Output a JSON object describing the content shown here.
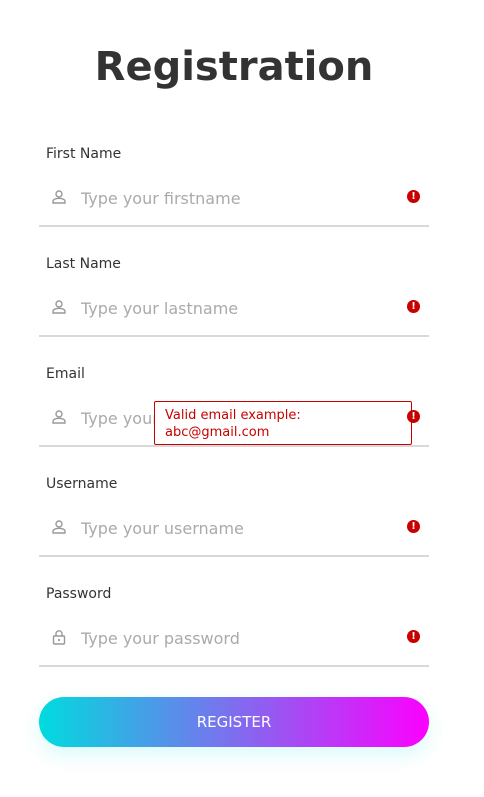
{
  "page": {
    "title": "Registration"
  },
  "colors": {
    "error": "#c80000",
    "gradient_start": "#00dbde",
    "gradient_end": "#fc00ff"
  },
  "fields": [
    {
      "label": "First Name",
      "placeholder": "Type your firstname",
      "value": "",
      "icon": "user-icon"
    },
    {
      "label": "Last Name",
      "placeholder": "Type your lastname",
      "value": "",
      "icon": "user-icon"
    },
    {
      "label": "Email",
      "placeholder": "Type your email",
      "value": "",
      "icon": "user-icon"
    },
    {
      "label": "Username",
      "placeholder": "Type your username",
      "value": "",
      "icon": "user-icon"
    },
    {
      "label": "Password",
      "placeholder": "Type your password",
      "value": "",
      "icon": "lock-icon"
    }
  ],
  "validation": {
    "alert_glyph": "!",
    "email_tooltip_line1": "Valid email example:",
    "email_tooltip_line2": "abc@gmail.com"
  },
  "actions": {
    "register_label": "REGISTER"
  }
}
